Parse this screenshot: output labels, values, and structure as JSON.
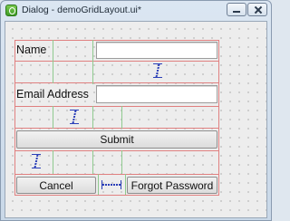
{
  "window": {
    "title": "Dialog - demoGridLayout.ui*"
  },
  "form": {
    "name_label": "Name",
    "name_value": "",
    "email_label": "Email Address",
    "email_value": "",
    "submit_label": "Submit",
    "cancel_label": "Cancel",
    "forgot_label": "Forgot Password"
  },
  "colors": {
    "layout_border": "#e08080",
    "spacer": "#2b3fb8",
    "splitter": "#8fca8f"
  }
}
